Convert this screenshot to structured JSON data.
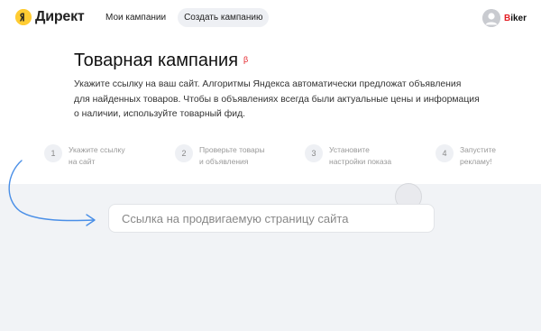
{
  "header": {
    "brand": "Директ",
    "nav": [
      "Мои кампании",
      "Создать кампанию"
    ],
    "user": {
      "first_letter": "B",
      "rest": "iker"
    }
  },
  "page": {
    "title": "Товарная кампания",
    "beta_badge": "β",
    "description_lines": [
      "Укажите ссылку на ваш сайт. Алгоритмы Яндекса автоматически предложат объявления",
      "для найденных товаров. Чтобы в объявлениях всегда были актуальные цены и информация",
      "о наличии, используйте товарный фид."
    ]
  },
  "steps": [
    {
      "num": "1",
      "line1": "Укажите ссылку",
      "line2": "на сайт"
    },
    {
      "num": "2",
      "line1": "Проверьте товары",
      "line2": "и объявления"
    },
    {
      "num": "3",
      "line1": "Установите",
      "line2": "настройки показа"
    },
    {
      "num": "4",
      "line1": "Запустите",
      "line2": "рекламу!"
    }
  ],
  "link_input": {
    "placeholder": "Ссылка на продвигаемую страницу сайта",
    "value": ""
  },
  "colors": {
    "accent": "#4a8fe7",
    "brand_yellow": "#ffcc33",
    "beta_red": "#e31e24",
    "muted_bg": "#f1f3f6"
  }
}
